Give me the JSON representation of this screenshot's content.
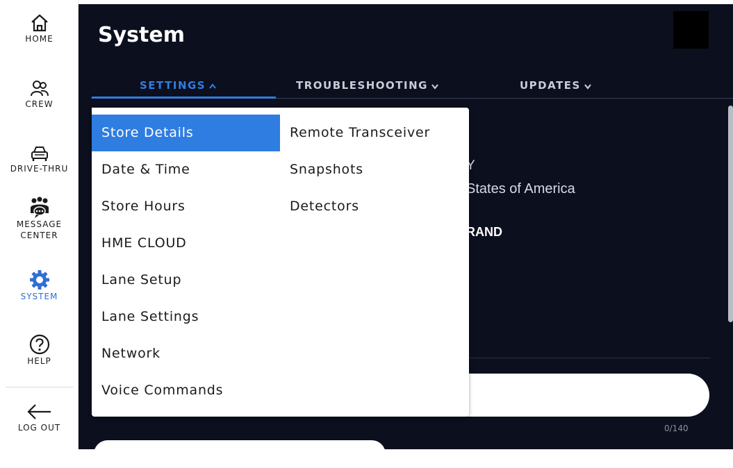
{
  "sidebar": {
    "items": [
      {
        "label": "HOME",
        "icon": "home-icon"
      },
      {
        "label": "CREW",
        "icon": "crew-icon"
      },
      {
        "label": "DRIVE-THRU",
        "icon": "car-icon"
      },
      {
        "label": "MESSAGE\nCENTER",
        "label_line1": "MESSAGE",
        "label_line2": "CENTER",
        "icon": "message-center-icon"
      },
      {
        "label": "SYSTEM",
        "icon": "gear-icon",
        "active": true
      },
      {
        "label": "HELP",
        "icon": "help-icon"
      },
      {
        "label": "LOG OUT",
        "icon": "arrow-left-icon"
      }
    ]
  },
  "header": {
    "title": "System"
  },
  "tabs": [
    {
      "label": "SETTINGS",
      "chevron": "up",
      "active": true
    },
    {
      "label": "TROUBLESHOOTING",
      "chevron": "down"
    },
    {
      "label": "UPDATES",
      "chevron": "down"
    }
  ],
  "background": {
    "partial_texts": [
      "Y",
      "States of America",
      "RAND"
    ],
    "message_counter": "0/140"
  },
  "dropdown": {
    "column1": [
      "Store Details",
      "Date & Time",
      "Store Hours",
      "HME CLOUD",
      "Lane Setup",
      "Lane Settings",
      "Network",
      "Voice Commands"
    ],
    "column2": [
      "Remote Transceiver",
      "Snapshots",
      "Detectors"
    ],
    "selected": "Store Details"
  },
  "colors": {
    "accent": "#2f7de1",
    "panel_bg": "#0c0f1e",
    "sidebar_bg": "#ffffff"
  }
}
